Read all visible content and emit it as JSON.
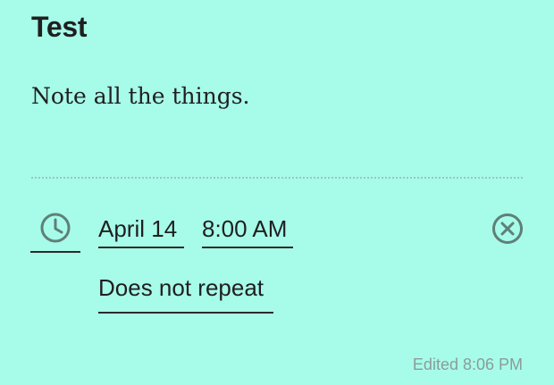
{
  "note": {
    "title": "Test",
    "body": "Note all the things."
  },
  "reminder": {
    "icon": "clock-icon",
    "date": "April 14",
    "time": "8:00 AM",
    "repeat": "Does not repeat",
    "clear_icon": "clear-circle-icon"
  },
  "footer": {
    "edited": "Edited 8:06 PM"
  },
  "colors": {
    "background": "#a7fbe9",
    "icon": "#5f7f78",
    "muted_text": "#8a9d99"
  }
}
